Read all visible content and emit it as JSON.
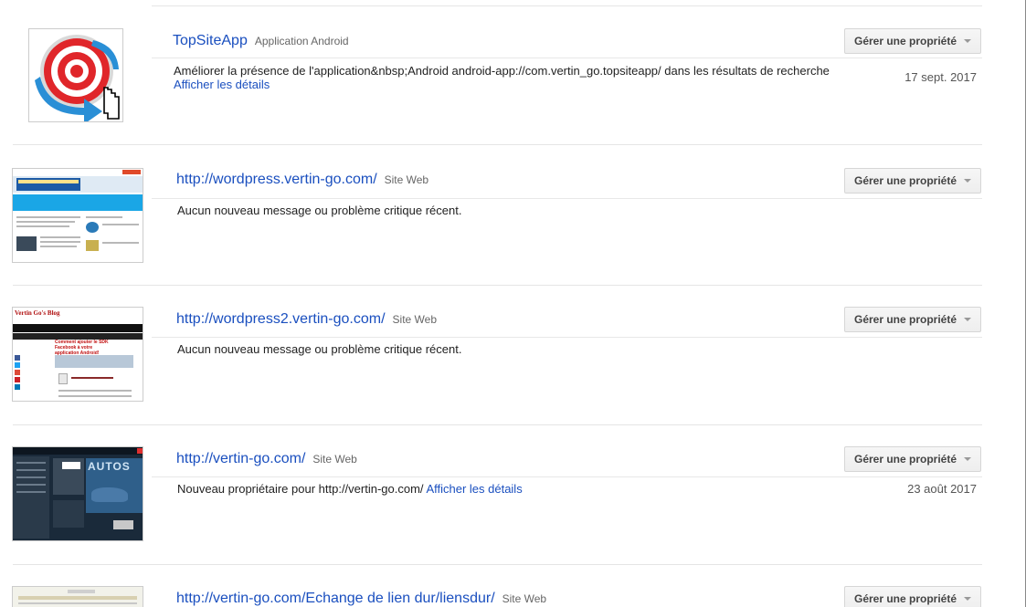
{
  "properties": [
    {
      "title": "TopSiteApp",
      "type": "Application Android",
      "message": "Améliorer la présence de l'application&nbsp;Android android-app://com.vertin_go.topsiteapp/ dans les résultats de recherche",
      "details_link": "Afficher les détails",
      "date": "17 sept. 2017",
      "button": "Gérer une propriété"
    },
    {
      "title": "http://wordpress.vertin-go.com/",
      "type": "Site Web",
      "message": "Aucun nouveau message ou problème critique récent.",
      "button": "Gérer une propriété"
    },
    {
      "title": "http://wordpress2.vertin-go.com/",
      "type": "Site Web",
      "message": "Aucun nouveau message ou problème critique récent.",
      "thumb_heading": "Vertin Go's Blog",
      "thumb_post": "Comment ajouter le SDK Facebook à votre application Android!",
      "button": "Gérer une propriété"
    },
    {
      "title": "http://vertin-go.com/",
      "type": "Site Web",
      "message": "Nouveau propriétaire pour http://vertin-go.com/",
      "details_link": "Afficher les détails",
      "date": "23 août 2017",
      "thumb_banner": "AUTOS",
      "button": "Gérer une propriété"
    },
    {
      "title": "http://vertin-go.com/Echange de lien dur/liensdur/",
      "type": "Site Web",
      "button": "Gérer une propriété"
    }
  ]
}
